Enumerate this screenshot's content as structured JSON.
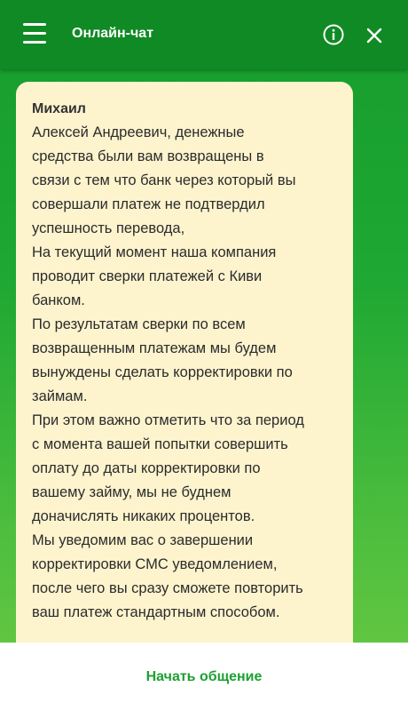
{
  "header": {
    "title": "Онлайн-чат",
    "menu_icon": "hamburger-menu-icon",
    "info_icon": "info-icon",
    "close_icon": "close-icon"
  },
  "message": {
    "sender": "Михаил",
    "lines": [
      "Алексей Андреевич, денежные",
      "средства были вам возвращены в",
      "связи с тем что банк через который вы",
      "совершали платеж не подтвердил",
      "успешность перевода,",
      "На текущий момент наша компания",
      "проводит сверки платежей с Киви",
      "банком.",
      "По результатам сверки по всем",
      "возвращенным платежам мы будем",
      "вынуждены сделать корректировки по",
      "займам.",
      "При этом важно отметить что за период",
      "с момента вашей попытки совершить",
      "оплату до даты корректировки по",
      "вашему займу, мы не буднем",
      "доначислять никаких процентов.",
      "Мы уведомим вас о завершении",
      "корректировки СМС уведомлением,",
      "после чего вы сразу сможете повторить",
      "ваш платеж стандартным способом."
    ]
  },
  "footer": {
    "start_label": "Начать общение"
  },
  "colors": {
    "header_bg": "#108a25",
    "bubble_bg": "#fdf4ce",
    "accent": "#1da033"
  }
}
